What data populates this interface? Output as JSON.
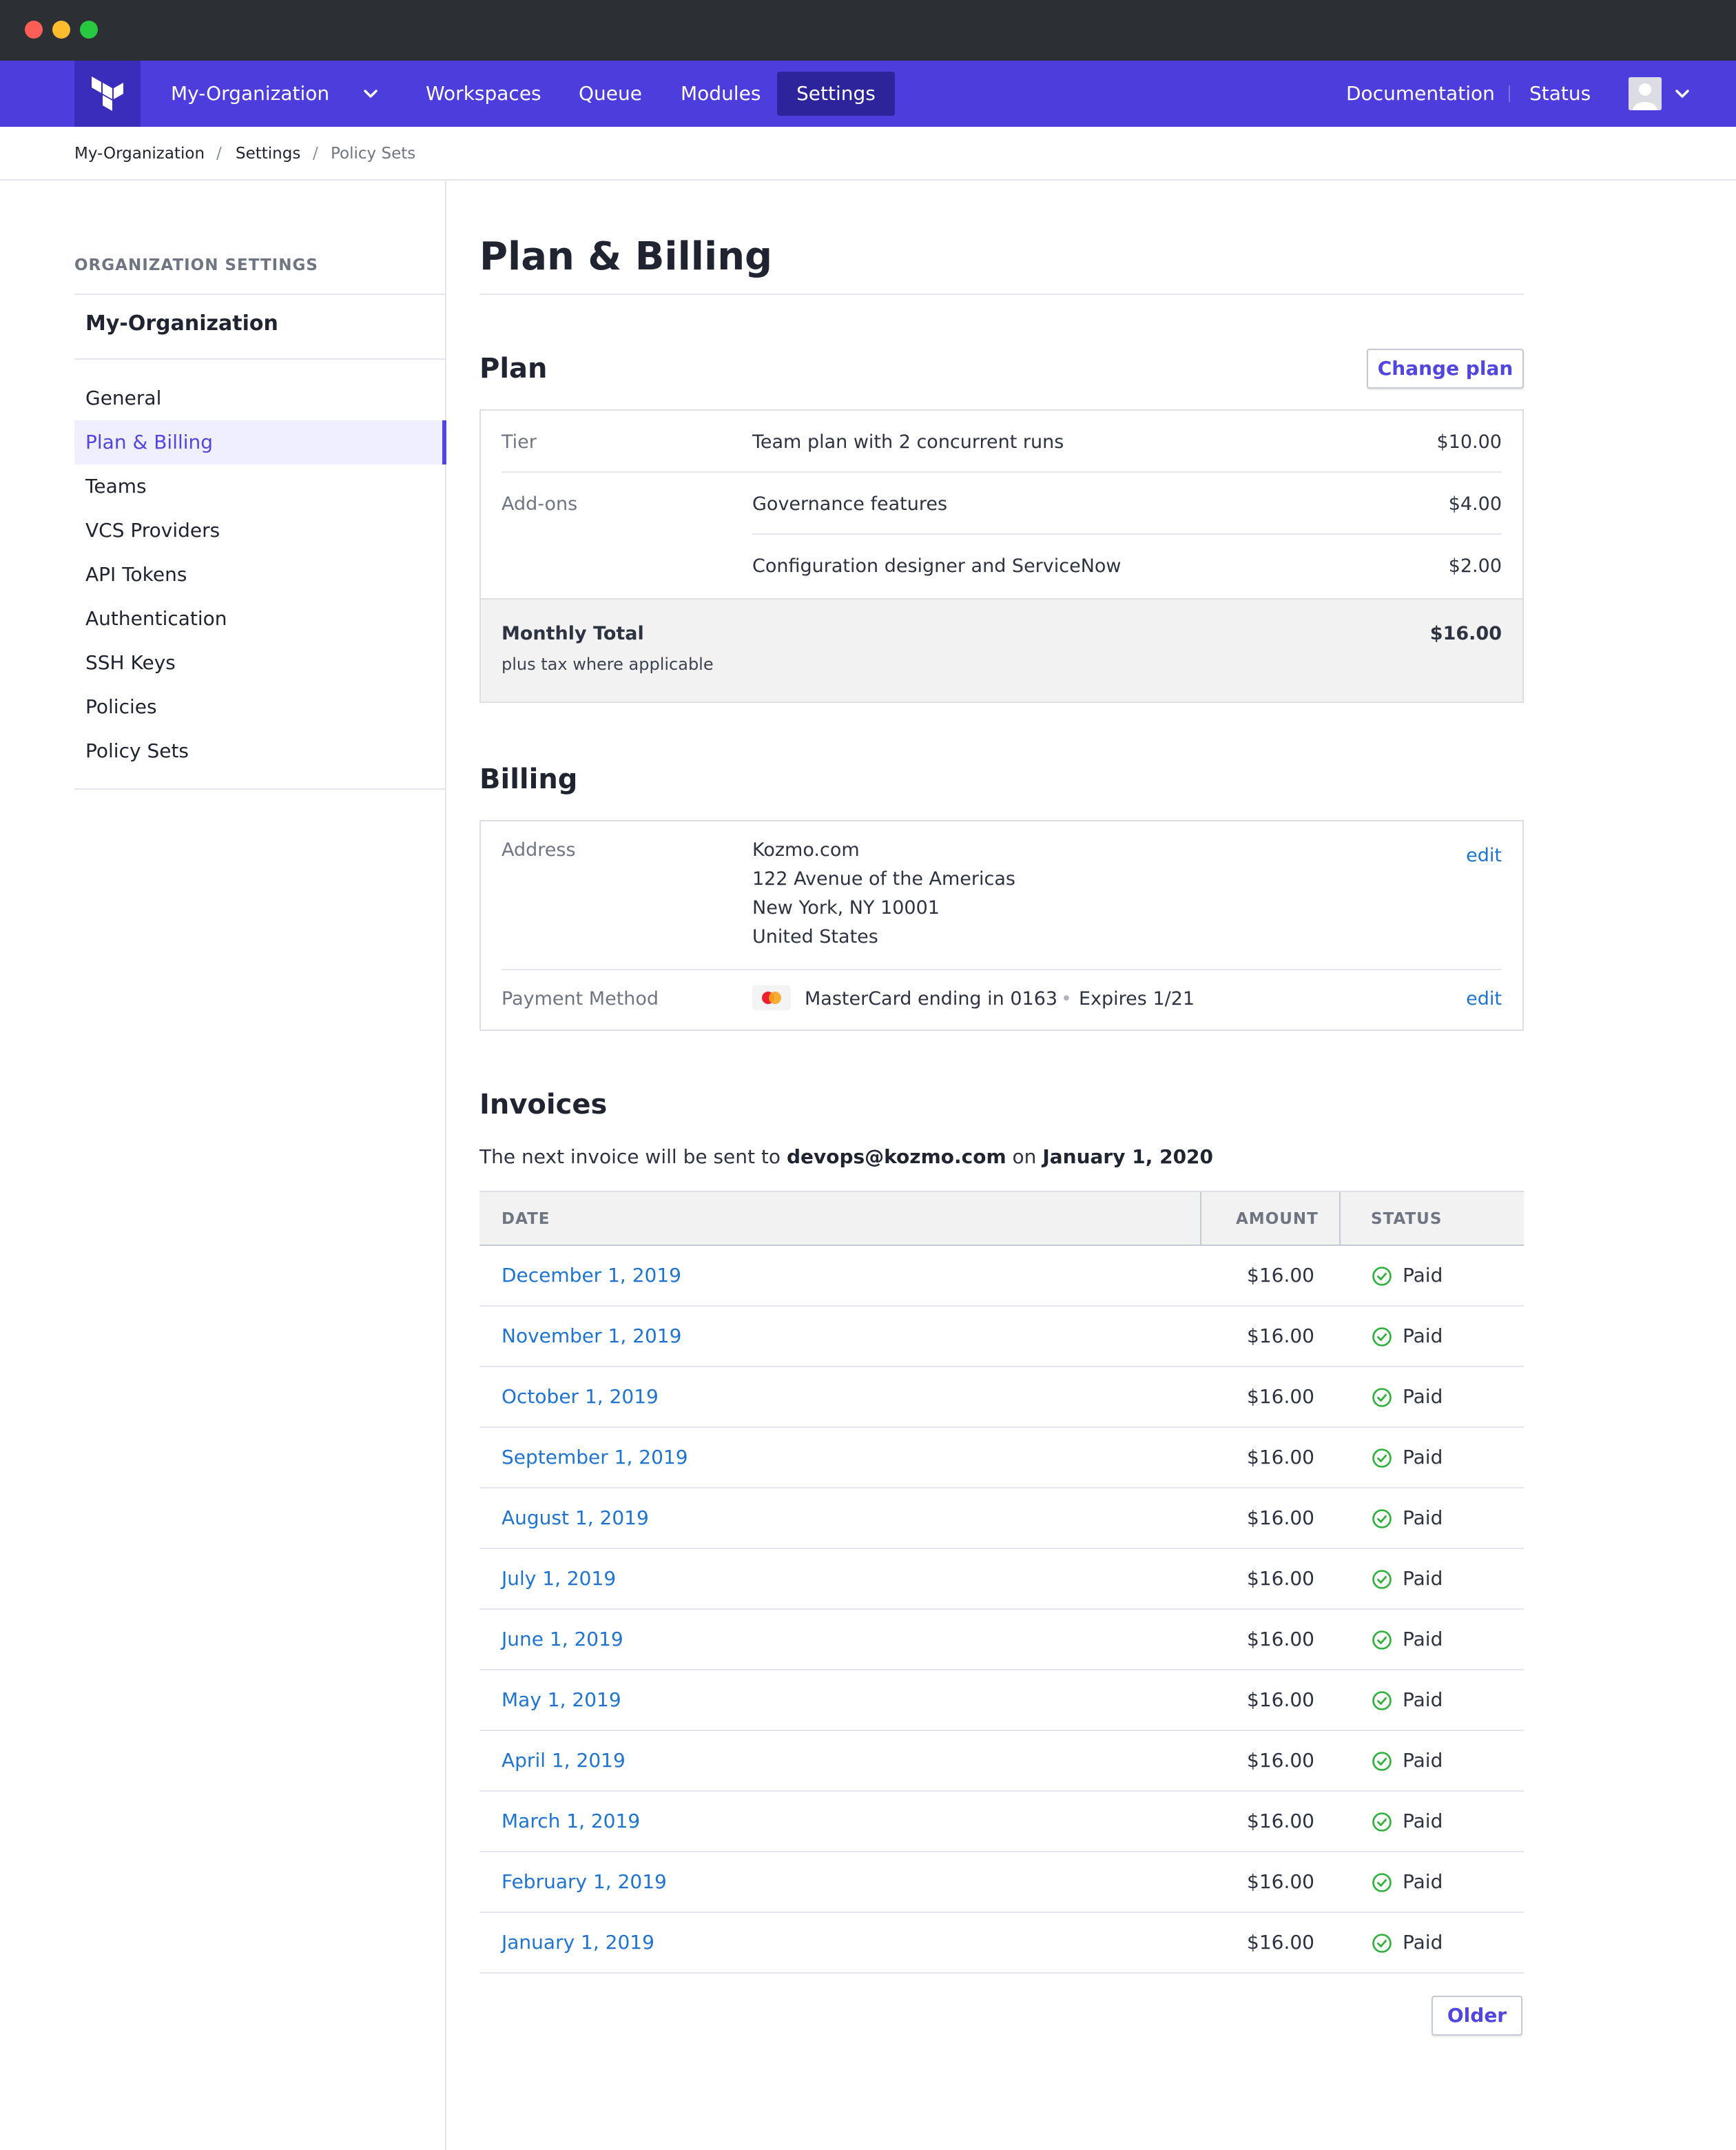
{
  "topnav": {
    "org_name": "My-Organization",
    "items": [
      {
        "label": "Workspaces",
        "active": false
      },
      {
        "label": "Queue",
        "active": false
      },
      {
        "label": "Modules",
        "active": false
      },
      {
        "label": "Settings",
        "active": true
      }
    ],
    "documentation": "Documentation",
    "status": "Status",
    "accent_color": "#4c3ddc"
  },
  "breadcrumb": {
    "org": "My-Organization",
    "settings": "Settings",
    "current": "Policy Sets",
    "separator": "/"
  },
  "sidebar": {
    "heading": "ORGANIZATION SETTINGS",
    "org_name": "My-Organization",
    "items": [
      {
        "label": "General",
        "active": false
      },
      {
        "label": "Plan & Billing",
        "active": true
      },
      {
        "label": "Teams",
        "active": false
      },
      {
        "label": "VCS Providers",
        "active": false
      },
      {
        "label": "API Tokens",
        "active": false
      },
      {
        "label": "Authentication",
        "active": false
      },
      {
        "label": "SSH Keys",
        "active": false
      },
      {
        "label": "Policies",
        "active": false
      },
      {
        "label": "Policy Sets",
        "active": false
      }
    ]
  },
  "page": {
    "title": "Plan & Billing"
  },
  "plan": {
    "title": "Plan",
    "change_button": "Change plan",
    "tier_label": "Tier",
    "tier_value": "Team plan with 2 concurrent runs",
    "tier_price": "$10.00",
    "addons_label": "Add-ons",
    "addons": [
      {
        "name": "Governance features",
        "price": "$4.00"
      },
      {
        "name": "Configuration designer and ServiceNow",
        "price": "$2.00"
      }
    ],
    "total_label": "Monthly Total",
    "total_note": "plus tax where applicable",
    "total_value": "$16.00"
  },
  "billing": {
    "title": "Billing",
    "address_label": "Address",
    "address_lines": [
      "Kozmo.com",
      "122 Avenue of the Americas",
      "New York, NY 10001",
      "United States"
    ],
    "edit_label": "edit",
    "payment_label": "Payment Method",
    "card_text": "MasterCard ending in 0163",
    "card_icon": "mastercard-icon",
    "expires": "Expires 1/21"
  },
  "invoices": {
    "title": "Invoices",
    "note_prefix": "The next invoice will be sent to",
    "email": "devops@kozmo.com",
    "note_on": "on",
    "next_date": "January 1, 2020",
    "columns": {
      "date": "DATE",
      "amount": "AMOUNT",
      "status": "STATUS"
    },
    "rows": [
      {
        "date": "December 1, 2019",
        "amount": "$16.00",
        "status": "Paid"
      },
      {
        "date": "November 1, 2019",
        "amount": "$16.00",
        "status": "Paid"
      },
      {
        "date": "October 1, 2019",
        "amount": "$16.00",
        "status": "Paid"
      },
      {
        "date": "September 1, 2019",
        "amount": "$16.00",
        "status": "Paid"
      },
      {
        "date": "August 1, 2019",
        "amount": "$16.00",
        "status": "Paid"
      },
      {
        "date": "July 1, 2019",
        "amount": "$16.00",
        "status": "Paid"
      },
      {
        "date": "June 1, 2019",
        "amount": "$16.00",
        "status": "Paid"
      },
      {
        "date": "May 1, 2019",
        "amount": "$16.00",
        "status": "Paid"
      },
      {
        "date": "April 1, 2019",
        "amount": "$16.00",
        "status": "Paid"
      },
      {
        "date": "March 1, 2019",
        "amount": "$16.00",
        "status": "Paid"
      },
      {
        "date": "February 1, 2019",
        "amount": "$16.00",
        "status": "Paid"
      },
      {
        "date": "January 1, 2019",
        "amount": "$16.00",
        "status": "Paid"
      }
    ],
    "older_button": "Older",
    "paid_color": "#2eb039",
    "link_color": "#1f74d2"
  }
}
